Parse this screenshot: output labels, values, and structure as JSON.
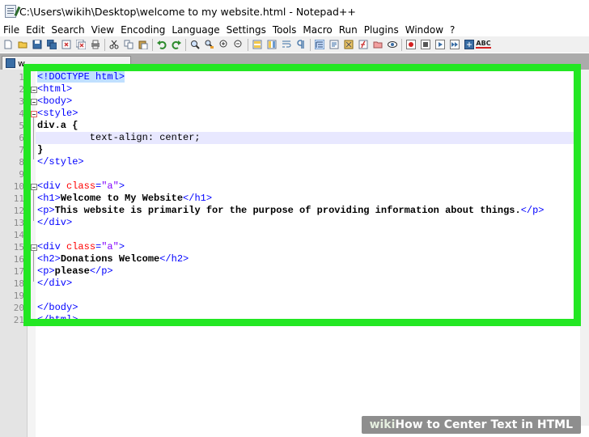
{
  "window": {
    "title": "C:\\Users\\wikih\\Desktop\\welcome to my website.html - Notepad++"
  },
  "menu": [
    "File",
    "Edit",
    "Search",
    "View",
    "Encoding",
    "Language",
    "Settings",
    "Tools",
    "Macro",
    "Run",
    "Plugins",
    "Window",
    "?"
  ],
  "toolbar": {
    "icons": [
      "new-file-icon",
      "open-file-icon",
      "save-icon",
      "save-all-icon",
      "close-icon",
      "close-all-icon",
      "print-icon",
      "cut-icon",
      "copy-icon",
      "paste-icon",
      "undo-icon",
      "redo-icon",
      "find-icon",
      "replace-icon",
      "zoom-in-icon",
      "zoom-out-icon",
      "sync-scroll-v-icon",
      "sync-scroll-h-icon",
      "word-wrap-icon",
      "show-all-chars-icon",
      "indent-guide-icon",
      "user-lang-icon",
      "doc-map-icon",
      "function-list-icon",
      "folder-workspace-icon",
      "monitoring-icon",
      "record-macro-icon",
      "stop-macro-icon",
      "play-macro-icon",
      "run-macro-multiple-icon",
      "save-macro-icon",
      "spellcheck-icon"
    ],
    "spellcheck_label": "ABC"
  },
  "tab": {
    "label": "w"
  },
  "line_numbers": [
    "1",
    "2",
    "3",
    "4",
    "5",
    "6",
    "7",
    "8",
    "9",
    "10",
    "11",
    "12",
    "13",
    "14",
    "15",
    "16",
    "17",
    "18",
    "19",
    "20",
    "21"
  ],
  "code": {
    "l1": "<!DOCTYPE html>",
    "l2": "<html>",
    "l3": "<body>",
    "l4": "<style>",
    "l5": "div.a {",
    "l6": "         text-align: center;",
    "l7": "}",
    "l8": "</style>",
    "l10_open": "<div ",
    "l10_attr": "class",
    "l10_eq": "=",
    "l10_val": "\"a\"",
    "l10_close": ">",
    "l11_open": "<h1>",
    "l11_text": "Welcome to My Website",
    "l11_close": "</h1>",
    "l12_open": "<p>",
    "l12_text": "This website is primarily for the purpose of providing information about things.",
    "l12_close": "</p>",
    "l13": "</div>",
    "l15_open": "<div ",
    "l15_attr": "class",
    "l15_eq": "=",
    "l15_val": "\"a\"",
    "l15_close": ">",
    "l16_open": "<h2>",
    "l16_text": "Donations Welcome",
    "l16_close": "</h2>",
    "l17_open": "<p>",
    "l17_text": "please",
    "l17_close": "</p>",
    "l18": "</div>",
    "l20": "</body>",
    "l21": "</html>"
  },
  "colors": {
    "highlight": "#23e723",
    "tag": "#0000ff",
    "attribute": "#ff0000",
    "string": "#8000ff"
  },
  "watermark": {
    "wiki": "wiki",
    "how": "How",
    "rest": " to Center Text in HTML"
  }
}
